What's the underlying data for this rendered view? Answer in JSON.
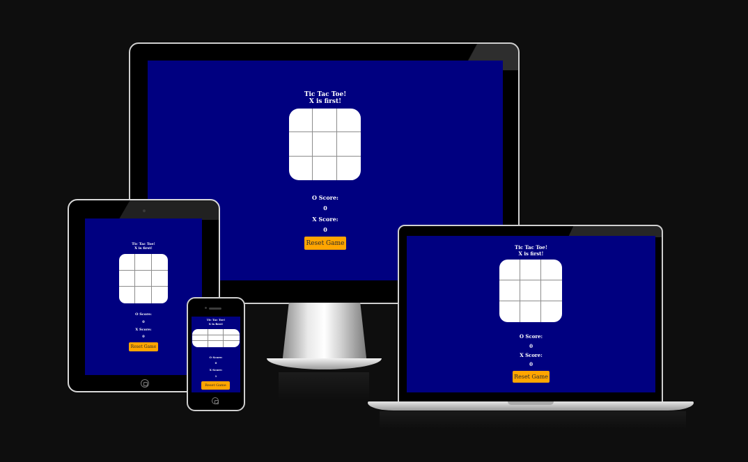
{
  "game": {
    "title": "Tic Tac Toe!",
    "turn_message": "X is first!",
    "o_score_label": "O Score:",
    "x_score_label": "X Score:",
    "reset_label": "Reset Game"
  },
  "devices": {
    "monitor": {
      "o_score": "0",
      "x_score": "0"
    },
    "tablet": {
      "o_score": "0",
      "x_score": "0"
    },
    "phone": {
      "o_score": "0",
      "x_score": "1"
    },
    "laptop": {
      "o_score": "0",
      "x_score": "0"
    }
  },
  "colors": {
    "background": "#0e0e0e",
    "screen": "#000080",
    "board": "#ffffff",
    "button": "#ffa500"
  }
}
